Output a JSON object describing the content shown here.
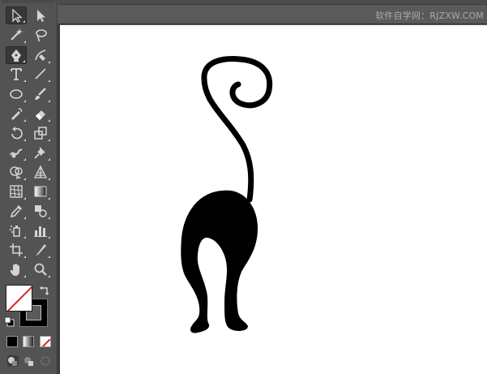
{
  "app": {
    "watermark": "软件自学网：RJZXW.COM"
  },
  "toolbar": {
    "tools": [
      {
        "name": "selection-tool",
        "icon": "selection-arrow-icon",
        "selected": true
      },
      {
        "name": "direct-selection-tool",
        "icon": "direct-selection-arrow-icon"
      },
      {
        "name": "magic-wand-tool",
        "icon": "magic-wand-icon"
      },
      {
        "name": "lasso-tool",
        "icon": "lasso-icon"
      },
      {
        "name": "pen-tool",
        "icon": "pen-icon",
        "selected": true
      },
      {
        "name": "curvature-tool",
        "icon": "curvature-icon"
      },
      {
        "name": "type-tool",
        "icon": "type-icon"
      },
      {
        "name": "line-segment-tool",
        "icon": "line-icon"
      },
      {
        "name": "ellipse-tool",
        "icon": "ellipse-icon"
      },
      {
        "name": "paintbrush-tool",
        "icon": "paintbrush-icon"
      },
      {
        "name": "shaper-tool",
        "icon": "shaper-icon"
      },
      {
        "name": "eraser-tool",
        "icon": "eraser-icon"
      },
      {
        "name": "rotate-tool",
        "icon": "rotate-icon"
      },
      {
        "name": "scale-tool",
        "icon": "scale-icon"
      },
      {
        "name": "warp-tool",
        "icon": "warp-icon"
      },
      {
        "name": "puppet-warp-tool",
        "icon": "pin-icon"
      },
      {
        "name": "shape-builder-tool",
        "icon": "shape-builder-icon"
      },
      {
        "name": "perspective-grid-tool",
        "icon": "perspective-grid-icon"
      },
      {
        "name": "mesh-tool",
        "icon": "mesh-icon"
      },
      {
        "name": "gradient-tool",
        "icon": "gradient-icon"
      },
      {
        "name": "eyedropper-tool",
        "icon": "eyedropper-icon"
      },
      {
        "name": "blend-tool",
        "icon": "blend-icon"
      },
      {
        "name": "symbol-sprayer-tool",
        "icon": "symbol-sprayer-icon"
      },
      {
        "name": "column-graph-tool",
        "icon": "column-graph-icon"
      },
      {
        "name": "artboard-tool",
        "icon": "artboard-icon"
      },
      {
        "name": "slice-tool",
        "icon": "slice-icon"
      },
      {
        "name": "hand-tool",
        "icon": "hand-icon"
      },
      {
        "name": "zoom-tool",
        "icon": "zoom-icon"
      }
    ]
  },
  "colors": {
    "fill": "#ffffff",
    "stroke": "#000000",
    "none_slash": "#e02020",
    "canvas": "#ffffff",
    "artwork": "#000000"
  },
  "color_modes": [
    "color",
    "gradient",
    "none"
  ],
  "draw_modes": [
    "draw-normal",
    "draw-behind",
    "draw-inside"
  ]
}
